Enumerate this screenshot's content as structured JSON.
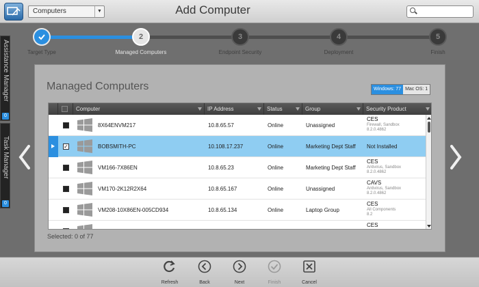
{
  "header": {
    "title": "Add Computer",
    "combo_value": "Computers",
    "search_placeholder": ""
  },
  "wizard": {
    "steps": [
      {
        "number": "1",
        "label": "Target Type",
        "state": "done"
      },
      {
        "number": "2",
        "label": "Managed Computers",
        "state": "active"
      },
      {
        "number": "3",
        "label": "Endpoint Security",
        "state": "pending"
      },
      {
        "number": "4",
        "label": "Deployment",
        "state": "pending"
      },
      {
        "number": "5",
        "label": "Finish",
        "state": "pending"
      }
    ],
    "progress_fraction": 0.25
  },
  "side_tabs": [
    {
      "label": "Assistance Manager",
      "badge": "0"
    },
    {
      "label": "Task Manager",
      "badge": "0"
    }
  ],
  "panel": {
    "title": "Managed Computers",
    "os_windows": "Windows: 77",
    "os_mac": "Mac OS: 1",
    "selected_text": "Selected: 0 of 77"
  },
  "table": {
    "columns": [
      "Computer",
      "IP Address",
      "Status",
      "Group",
      "Security Product"
    ],
    "rows": [
      {
        "computer": "8X64ENVM217",
        "ip": "10.8.65.57",
        "status": "Online",
        "group": "Unassigned",
        "product": "CES",
        "product_sub1": "Firewall, Sandbox",
        "product_sub2": "8.2.0.4862",
        "selected": false,
        "checked": false
      },
      {
        "computer": "BOBSMITH-PC",
        "ip": "10.108.17.237",
        "status": "Online",
        "group": "Marketing Dept Staff",
        "product": "Not Installed",
        "product_sub1": "",
        "product_sub2": "",
        "selected": true,
        "checked": true
      },
      {
        "computer": "VM166-7X86EN",
        "ip": "10.8.65.23",
        "status": "Online",
        "group": "Marketing Dept Staff",
        "product": "CES",
        "product_sub1": "Antivirus, Sandbox",
        "product_sub2": "8.2.0.4862",
        "selected": false,
        "checked": false
      },
      {
        "computer": "VM170-2K12R2X64",
        "ip": "10.8.65.167",
        "status": "Online",
        "group": "Unassigned",
        "product": "CAVS",
        "product_sub1": "Antivirus, Sandbox",
        "product_sub2": "8.2.0.4862",
        "selected": false,
        "checked": false
      },
      {
        "computer": "VM208-10X86EN-005CD934",
        "ip": "10.8.65.134",
        "status": "Online",
        "group": "Laptop Group",
        "product": "CES",
        "product_sub1": "All Components",
        "product_sub2": "8.2",
        "selected": false,
        "checked": false
      },
      {
        "computer": "",
        "ip": "",
        "status": "",
        "group": "",
        "product": "CES",
        "product_sub1": "",
        "product_sub2": "",
        "selected": false,
        "checked": false
      }
    ]
  },
  "toolbar": {
    "refresh": "Refresh",
    "back": "Back",
    "next": "Next",
    "finish": "Finish",
    "cancel": "Cancel"
  },
  "colors": {
    "accent": "#2b8fe0",
    "selected_row": "#8fcdf2"
  }
}
